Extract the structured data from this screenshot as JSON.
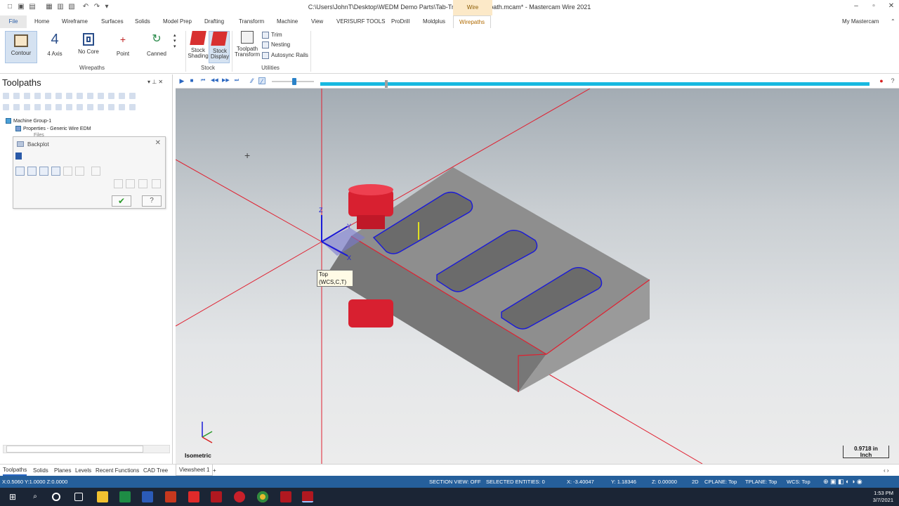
{
  "window": {
    "title": "C:\\Users\\JohnT\\Desktop\\WEDM Demo Parts\\Tab-Transform Toolpath.mcam* - Mastercam Wire 2021",
    "context_tab": "Wire"
  },
  "tabs": [
    "File",
    "Home",
    "Wireframe",
    "Surfaces",
    "Solids",
    "Model Prep",
    "Drafting",
    "Transform",
    "Machine",
    "View",
    "VERISURF TOOLS",
    "ProDrill",
    "Moldplus",
    "Wirepaths"
  ],
  "my_mastercam": "My Mastercam",
  "ribbon": {
    "wirepaths": {
      "contour": "Contour",
      "four_axis": "4 Axis",
      "no_core": "No Core",
      "point": "Point",
      "canned": "Canned",
      "group": "Wirepaths"
    },
    "stock": {
      "shading": "Stock Shading",
      "display": "Stock Display",
      "group": "Stock"
    },
    "utilities": {
      "transform": "Toolpath Transform",
      "trim": "Trim",
      "nesting": "Nesting",
      "autosync": "Autosync Rails",
      "group": "Utilities"
    }
  },
  "toolpaths_panel": {
    "title": "Toolpaths",
    "tree": {
      "group": "Machine Group-1",
      "properties": "Properties - Generic Wire EDM",
      "files": "Files"
    }
  },
  "backplot": {
    "title": "Backplot"
  },
  "viewport": {
    "tooltip_line1": "Top",
    "tooltip_line2": "(WCS,C,T)",
    "view_name": "Isometric",
    "scale_value": "0.9718 in",
    "scale_unit": "Inch",
    "axis_labels": {
      "z": "Z",
      "y": "Y",
      "x": "X"
    }
  },
  "bottom_tabs": [
    "Toolpaths",
    "Solids",
    "Planes",
    "Levels",
    "Recent Functions",
    "CAD Tree"
  ],
  "viewsheet": "Viewsheet 1",
  "status": {
    "coords_left": "X:0.5060  Y:1.0000  Z:0.0000",
    "section_view": "SECTION VIEW: OFF",
    "selected": "SELECTED ENTITIES: 0",
    "x": "X:   -3.40047",
    "y": "Y:   1.18346",
    "z": "Z:   0.00000",
    "mode": "2D",
    "cplane": "CPLANE: Top",
    "tplane": "TPLANE: Top",
    "wcs": "WCS: Top"
  },
  "taskbar": {
    "time": "1:53 PM",
    "date": "3/7/2021"
  },
  "colors": {
    "accent": "#2a66c0",
    "statusbar": "#255f9b",
    "stock_red": "#e02030",
    "wire_blue": "#1a1ad8"
  }
}
